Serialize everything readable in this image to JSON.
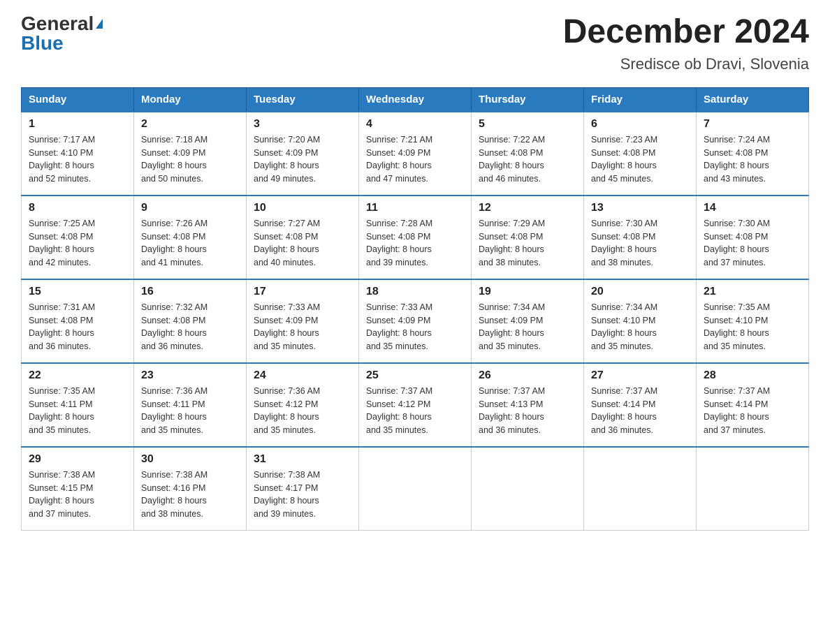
{
  "header": {
    "logo_general": "General",
    "logo_blue": "Blue",
    "month_title": "December 2024",
    "location": "Sredisce ob Dravi, Slovenia"
  },
  "weekdays": [
    "Sunday",
    "Monday",
    "Tuesday",
    "Wednesday",
    "Thursday",
    "Friday",
    "Saturday"
  ],
  "weeks": [
    [
      {
        "day": "1",
        "sunrise": "7:17 AM",
        "sunset": "4:10 PM",
        "daylight": "8 hours and 52 minutes."
      },
      {
        "day": "2",
        "sunrise": "7:18 AM",
        "sunset": "4:09 PM",
        "daylight": "8 hours and 50 minutes."
      },
      {
        "day": "3",
        "sunrise": "7:20 AM",
        "sunset": "4:09 PM",
        "daylight": "8 hours and 49 minutes."
      },
      {
        "day": "4",
        "sunrise": "7:21 AM",
        "sunset": "4:09 PM",
        "daylight": "8 hours and 47 minutes."
      },
      {
        "day": "5",
        "sunrise": "7:22 AM",
        "sunset": "4:08 PM",
        "daylight": "8 hours and 46 minutes."
      },
      {
        "day": "6",
        "sunrise": "7:23 AM",
        "sunset": "4:08 PM",
        "daylight": "8 hours and 45 minutes."
      },
      {
        "day": "7",
        "sunrise": "7:24 AM",
        "sunset": "4:08 PM",
        "daylight": "8 hours and 43 minutes."
      }
    ],
    [
      {
        "day": "8",
        "sunrise": "7:25 AM",
        "sunset": "4:08 PM",
        "daylight": "8 hours and 42 minutes."
      },
      {
        "day": "9",
        "sunrise": "7:26 AM",
        "sunset": "4:08 PM",
        "daylight": "8 hours and 41 minutes."
      },
      {
        "day": "10",
        "sunrise": "7:27 AM",
        "sunset": "4:08 PM",
        "daylight": "8 hours and 40 minutes."
      },
      {
        "day": "11",
        "sunrise": "7:28 AM",
        "sunset": "4:08 PM",
        "daylight": "8 hours and 39 minutes."
      },
      {
        "day": "12",
        "sunrise": "7:29 AM",
        "sunset": "4:08 PM",
        "daylight": "8 hours and 38 minutes."
      },
      {
        "day": "13",
        "sunrise": "7:30 AM",
        "sunset": "4:08 PM",
        "daylight": "8 hours and 38 minutes."
      },
      {
        "day": "14",
        "sunrise": "7:30 AM",
        "sunset": "4:08 PM",
        "daylight": "8 hours and 37 minutes."
      }
    ],
    [
      {
        "day": "15",
        "sunrise": "7:31 AM",
        "sunset": "4:08 PM",
        "daylight": "8 hours and 36 minutes."
      },
      {
        "day": "16",
        "sunrise": "7:32 AM",
        "sunset": "4:08 PM",
        "daylight": "8 hours and 36 minutes."
      },
      {
        "day": "17",
        "sunrise": "7:33 AM",
        "sunset": "4:09 PM",
        "daylight": "8 hours and 35 minutes."
      },
      {
        "day": "18",
        "sunrise": "7:33 AM",
        "sunset": "4:09 PM",
        "daylight": "8 hours and 35 minutes."
      },
      {
        "day": "19",
        "sunrise": "7:34 AM",
        "sunset": "4:09 PM",
        "daylight": "8 hours and 35 minutes."
      },
      {
        "day": "20",
        "sunrise": "7:34 AM",
        "sunset": "4:10 PM",
        "daylight": "8 hours and 35 minutes."
      },
      {
        "day": "21",
        "sunrise": "7:35 AM",
        "sunset": "4:10 PM",
        "daylight": "8 hours and 35 minutes."
      }
    ],
    [
      {
        "day": "22",
        "sunrise": "7:35 AM",
        "sunset": "4:11 PM",
        "daylight": "8 hours and 35 minutes."
      },
      {
        "day": "23",
        "sunrise": "7:36 AM",
        "sunset": "4:11 PM",
        "daylight": "8 hours and 35 minutes."
      },
      {
        "day": "24",
        "sunrise": "7:36 AM",
        "sunset": "4:12 PM",
        "daylight": "8 hours and 35 minutes."
      },
      {
        "day": "25",
        "sunrise": "7:37 AM",
        "sunset": "4:12 PM",
        "daylight": "8 hours and 35 minutes."
      },
      {
        "day": "26",
        "sunrise": "7:37 AM",
        "sunset": "4:13 PM",
        "daylight": "8 hours and 36 minutes."
      },
      {
        "day": "27",
        "sunrise": "7:37 AM",
        "sunset": "4:14 PM",
        "daylight": "8 hours and 36 minutes."
      },
      {
        "day": "28",
        "sunrise": "7:37 AM",
        "sunset": "4:14 PM",
        "daylight": "8 hours and 37 minutes."
      }
    ],
    [
      {
        "day": "29",
        "sunrise": "7:38 AM",
        "sunset": "4:15 PM",
        "daylight": "8 hours and 37 minutes."
      },
      {
        "day": "30",
        "sunrise": "7:38 AM",
        "sunset": "4:16 PM",
        "daylight": "8 hours and 38 minutes."
      },
      {
        "day": "31",
        "sunrise": "7:38 AM",
        "sunset": "4:17 PM",
        "daylight": "8 hours and 39 minutes."
      },
      null,
      null,
      null,
      null
    ]
  ],
  "labels": {
    "sunrise": "Sunrise:",
    "sunset": "Sunset:",
    "daylight": "Daylight:"
  }
}
